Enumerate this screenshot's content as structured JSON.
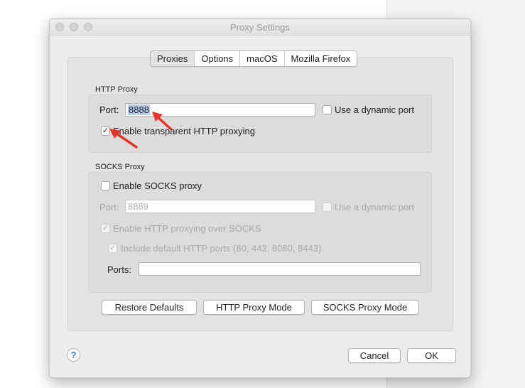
{
  "window": {
    "title": "Proxy Settings"
  },
  "tabs": [
    "Proxies",
    "Options",
    "macOS",
    "Mozilla Firefox"
  ],
  "active_tab": "Proxies",
  "http_proxy": {
    "group_label": "HTTP Proxy",
    "port_label": "Port:",
    "port_value": "8888",
    "dynamic_port_label": "Use a dynamic port",
    "dynamic_port_checked": false,
    "transparent_label": "Enable transparent HTTP proxying",
    "transparent_checked": true
  },
  "socks_proxy": {
    "group_label": "SOCKS Proxy",
    "enable_label": "Enable SOCKS proxy",
    "enable_checked": false,
    "port_label": "Port:",
    "port_value": "8889",
    "dynamic_port_label": "Use a dynamic port",
    "http_over_socks_label": "Enable HTTP proxying over SOCKS",
    "http_over_socks_checked": true,
    "default_ports_label": "Include default HTTP ports (80, 443, 8080, 8443)",
    "default_ports_checked": true,
    "ports_label": "Ports:",
    "ports_value": ""
  },
  "buttons": {
    "restore_defaults": "Restore Defaults",
    "http_proxy_mode": "HTTP Proxy Mode",
    "socks_proxy_mode": "SOCKS Proxy Mode",
    "cancel": "Cancel",
    "ok": "OK",
    "help": "?"
  },
  "colors": {
    "annotation_arrow": "#e8332a",
    "selection": "#b4cff0"
  },
  "checkmark": "✓"
}
